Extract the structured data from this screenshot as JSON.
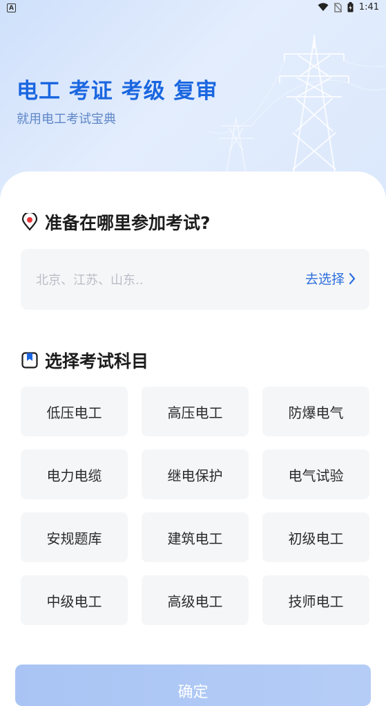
{
  "status_bar": {
    "time": "1:41"
  },
  "hero": {
    "title": "电工 考证 考级 复审",
    "subtitle": "就用电工考试宝典"
  },
  "location": {
    "title": "准备在哪里参加考试?",
    "placeholder": "北京、江苏、山东..",
    "select_label": "去选择"
  },
  "subjects": {
    "title": "选择考试科目",
    "items": [
      {
        "label": "低压电工"
      },
      {
        "label": "高压电工"
      },
      {
        "label": "防爆电气"
      },
      {
        "label": "电力电缆"
      },
      {
        "label": "继电保护"
      },
      {
        "label": "电气试验"
      },
      {
        "label": "安规题库"
      },
      {
        "label": "建筑电工"
      },
      {
        "label": "初级电工"
      },
      {
        "label": "中级电工"
      },
      {
        "label": "高级电工"
      },
      {
        "label": "技师电工"
      }
    ]
  },
  "confirm_label": "确定",
  "colors": {
    "accent": "#1a66e0",
    "link": "#2c6fdc",
    "tile_bg": "#f5f6f8",
    "button_disabled": "#a9c4f4"
  },
  "icons": {
    "status": [
      "app-notification-icon",
      "wifi-icon",
      "no-sim-icon",
      "battery-icon"
    ],
    "location": "location-pin-icon",
    "subjects": "bookmark-icon",
    "select": "chevron-right-icon"
  }
}
